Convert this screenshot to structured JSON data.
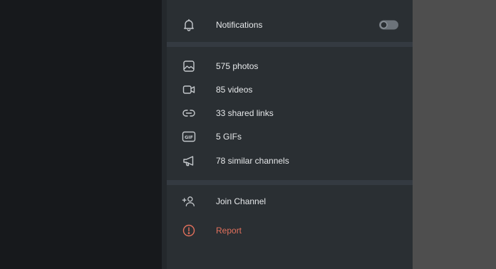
{
  "colors": {
    "panel_bg": "#2a2f33",
    "separator": "#343a41",
    "text": "#e6e8ea",
    "danger": "#e1705c",
    "icon": "#c4c8cc",
    "toggle_track": "#6c737a",
    "left_bg": "#17191c",
    "right_bg": "#4e4e4e"
  },
  "notifications": {
    "icon": "bell-icon",
    "label": "Notifications",
    "toggle_on": false
  },
  "media": [
    {
      "icon": "photo-icon",
      "label": "575 photos"
    },
    {
      "icon": "video-icon",
      "label": "85 videos"
    },
    {
      "icon": "link-icon",
      "label": "33 shared links"
    },
    {
      "icon": "gif-icon",
      "label": "5 GIFs"
    },
    {
      "icon": "megaphone-icon",
      "label": "78 similar channels"
    }
  ],
  "actions": [
    {
      "icon": "add-user-icon",
      "label": "Join Channel"
    },
    {
      "icon": "report-icon",
      "label": "Report"
    }
  ]
}
